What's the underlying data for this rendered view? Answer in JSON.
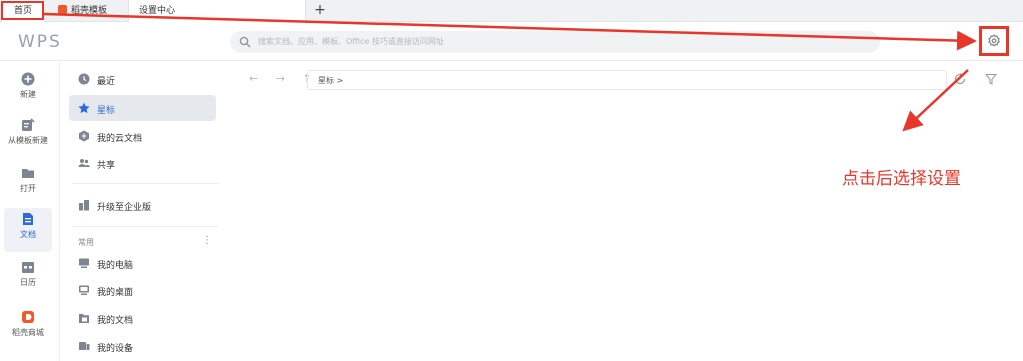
{
  "tabs": {
    "home": "首页",
    "daoke_template": "稻壳模板",
    "settings_center": "设置中心",
    "new_tab": "+"
  },
  "header": {
    "logo": "WPS",
    "search_placeholder": "搜索文档、应用、模板、Office 技巧或直接访问网址"
  },
  "rail": [
    {
      "label": "新建",
      "icon": "plus-circle-icon"
    },
    {
      "label": "从模板新建",
      "icon": "template-icon"
    },
    {
      "label": "打开",
      "icon": "folder-icon"
    },
    {
      "label": "文档",
      "icon": "document-icon"
    },
    {
      "label": "日历",
      "icon": "calendar-icon"
    },
    {
      "label": "稻壳商城",
      "icon": "daoke-store-icon"
    }
  ],
  "nav": {
    "items": [
      {
        "label": "最近",
        "icon": "clock-icon"
      },
      {
        "label": "星标",
        "icon": "star-icon"
      },
      {
        "label": "我的云文档",
        "icon": "cloud-doc-icon"
      },
      {
        "label": "共享",
        "icon": "share-users-icon"
      }
    ],
    "upgrade": "升级至企业版",
    "group_label": "常用",
    "group_more": "⋮",
    "locations": [
      {
        "label": "我的电脑",
        "icon": "computer-icon"
      },
      {
        "label": "我的桌面",
        "icon": "desktop-icon"
      },
      {
        "label": "我的文档",
        "icon": "documents-folder-icon"
      },
      {
        "label": "我的设备",
        "icon": "device-icon"
      }
    ]
  },
  "content": {
    "nav_arrows": "← → ↑",
    "path": "星标 >"
  },
  "annotation": {
    "text": "点击后选择设置"
  },
  "colors": {
    "annotation_red": "#e8362a",
    "accent_blue": "#2e6bd9",
    "daoke_orange": "#f05a28"
  }
}
